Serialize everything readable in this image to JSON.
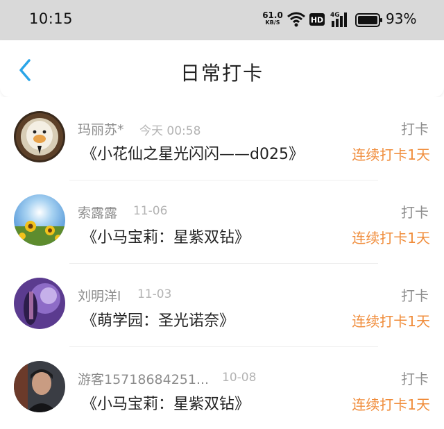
{
  "status_bar": {
    "time": "10:15",
    "net_speed": "61.0",
    "net_unit": "KB/S",
    "hd": "HD",
    "network": "4G",
    "battery": "93%"
  },
  "header": {
    "title": "日常打卡",
    "back_icon": "chevron-left-icon"
  },
  "colors": {
    "accent_blue": "#2aa5e8",
    "streak_orange": "#f08c3a"
  },
  "checkins": [
    {
      "user": "玛丽苏*",
      "time": "今天 00:58",
      "book": "《小花仙之星光闪闪——d025》",
      "action": "打卡",
      "streak": "连续打卡1天"
    },
    {
      "user": "索露露",
      "time": "11-06",
      "book": "《小马宝莉：星紫双钻》",
      "action": "打卡",
      "streak": "连续打卡1天"
    },
    {
      "user": "刘明洋l",
      "time": "11-03",
      "book": "《萌学园：圣光诺奈》",
      "action": "打卡",
      "streak": "连续打卡1天"
    },
    {
      "user": "游客15718684251...",
      "time": "10-08",
      "book": "《小马宝莉：星紫双钻》",
      "action": "打卡",
      "streak": "连续打卡1天"
    }
  ]
}
